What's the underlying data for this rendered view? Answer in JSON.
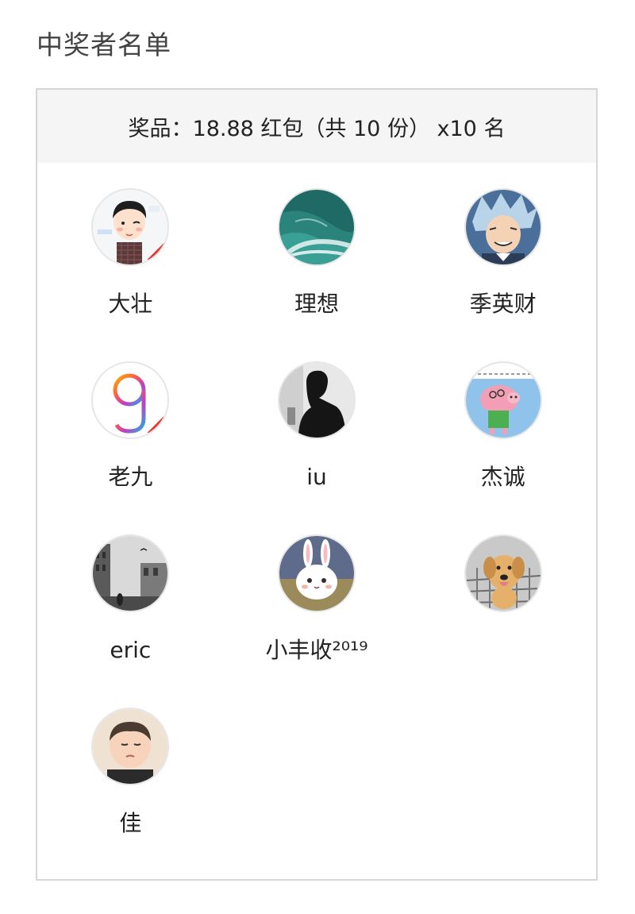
{
  "page": {
    "title": "中奖者名单"
  },
  "prize": {
    "text": "奖品：18.88 红包（共 10 份） x10 名"
  },
  "winners": [
    {
      "name": "大壮"
    },
    {
      "name": "理想"
    },
    {
      "name": "季英财"
    },
    {
      "name": "老九"
    },
    {
      "name": "iu"
    },
    {
      "name": "杰诚"
    },
    {
      "name": "eric"
    },
    {
      "name": "小丰收²⁰¹⁹"
    },
    {
      "name": ""
    },
    {
      "name": "佳"
    }
  ]
}
